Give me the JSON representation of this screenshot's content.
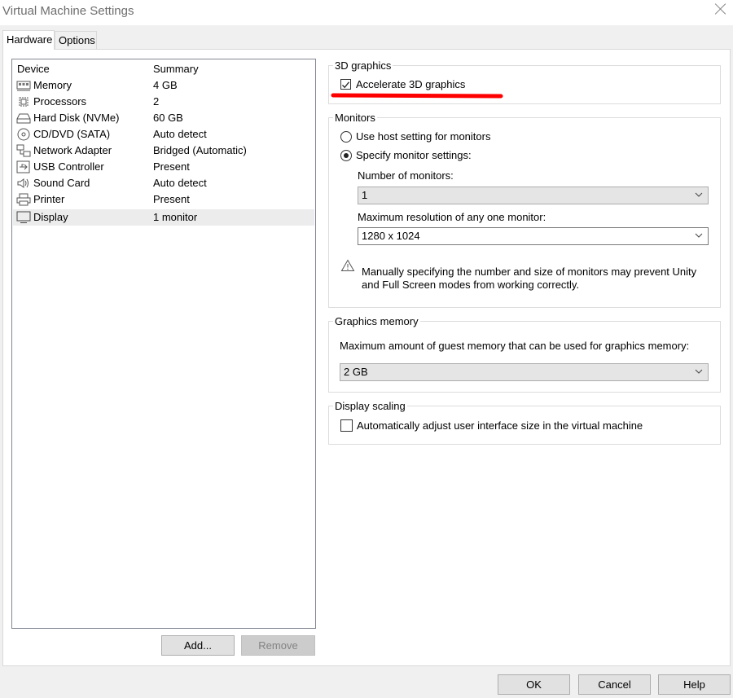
{
  "window": {
    "title": "Virtual Machine Settings"
  },
  "tabs": [
    {
      "label": "Hardware"
    },
    {
      "label": "Options"
    }
  ],
  "device_list": {
    "headers": {
      "device": "Device",
      "summary": "Summary"
    },
    "rows": [
      {
        "name": "Memory",
        "summary": "4 GB",
        "icon": "memory-icon"
      },
      {
        "name": "Processors",
        "summary": "2",
        "icon": "processor-icon"
      },
      {
        "name": "Hard Disk (NVMe)",
        "summary": "60 GB",
        "icon": "hard-disk-icon"
      },
      {
        "name": "CD/DVD (SATA)",
        "summary": "Auto detect",
        "icon": "cd-dvd-icon"
      },
      {
        "name": "Network Adapter",
        "summary": "Bridged (Automatic)",
        "icon": "network-icon"
      },
      {
        "name": "USB Controller",
        "summary": "Present",
        "icon": "usb-icon"
      },
      {
        "name": "Sound Card",
        "summary": "Auto detect",
        "icon": "sound-icon"
      },
      {
        "name": "Printer",
        "summary": "Present",
        "icon": "printer-icon"
      },
      {
        "name": "Display",
        "summary": "1 monitor",
        "icon": "display-icon",
        "selected": true
      }
    ],
    "add_label": "Add...",
    "remove_label": "Remove"
  },
  "graphics_3d": {
    "legend": "3D graphics",
    "accelerate_label": "Accelerate 3D graphics",
    "accelerate_checked": true,
    "highlight_color": "#ff0000"
  },
  "monitors": {
    "legend": "Monitors",
    "use_host_label": "Use host setting for monitors",
    "specify_label": "Specify monitor settings:",
    "selected_option": "specify",
    "number_label": "Number of monitors:",
    "number_value": "1",
    "max_res_label": "Maximum resolution of any one monitor:",
    "max_res_value": "1280 x 1024",
    "warning_line1": "Manually specifying the number and size of monitors may prevent Unity",
    "warning_line2": "and Full Screen modes from working correctly."
  },
  "graphics_memory": {
    "legend": "Graphics memory",
    "description": "Maximum amount of guest memory that can be used for graphics memory:",
    "value": "2 GB"
  },
  "display_scaling": {
    "legend": "Display scaling",
    "auto_adjust_label": "Automatically adjust user interface size in the virtual machine",
    "auto_adjust_checked": false
  },
  "footer": {
    "ok_label": "OK",
    "cancel_label": "Cancel",
    "help_label": "Help"
  }
}
